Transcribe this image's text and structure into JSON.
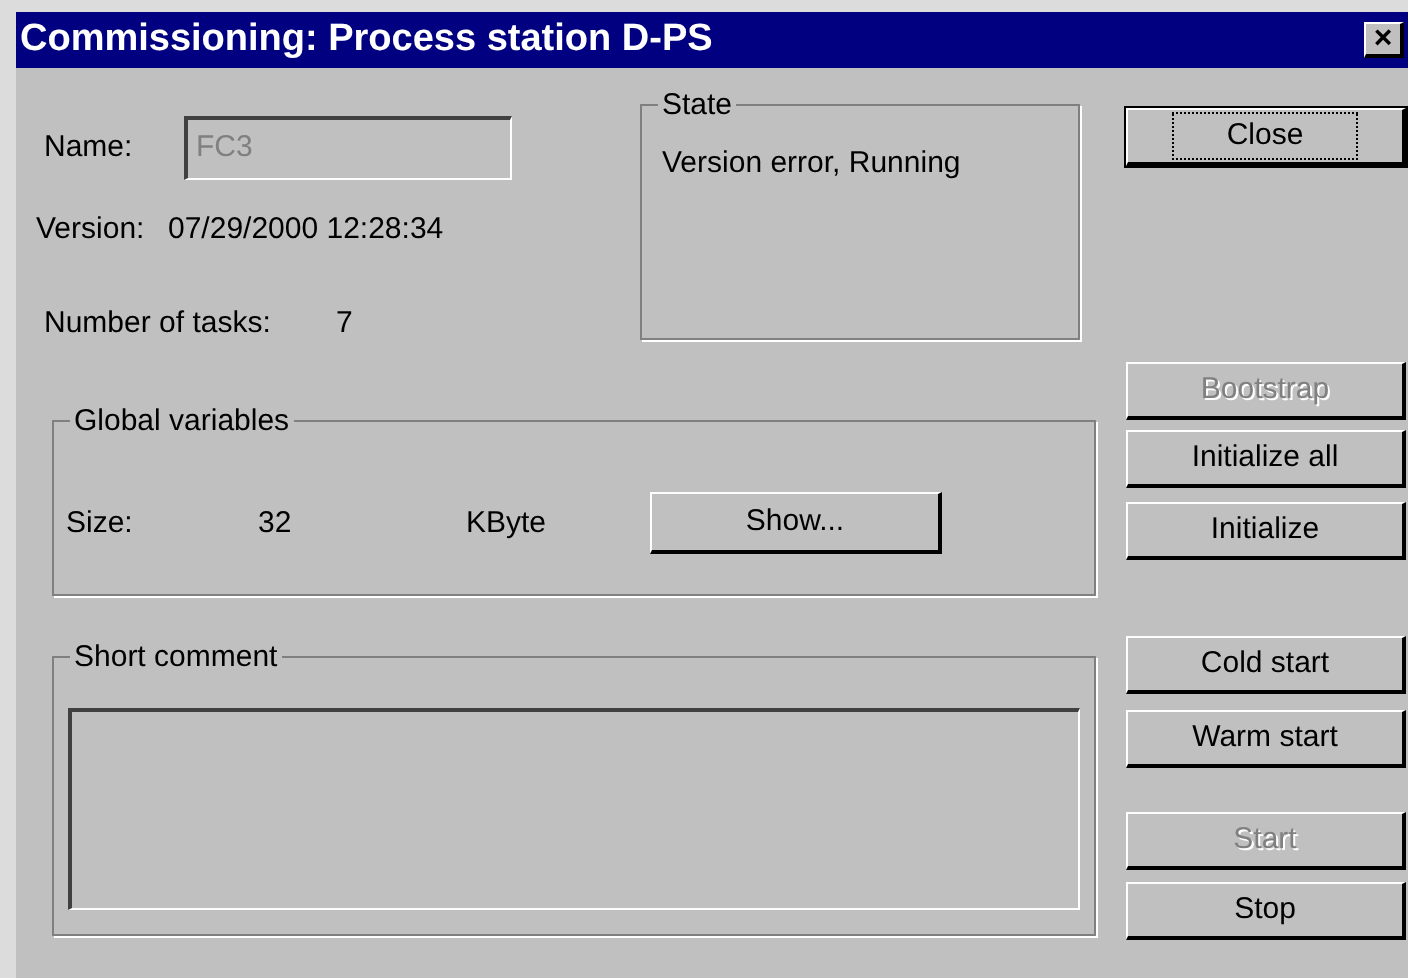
{
  "window": {
    "title": "Commissioning: Process station D-PS",
    "close_symbol": "×"
  },
  "name_field": {
    "label": "Name:",
    "value": "FC3",
    "disabled": true
  },
  "version": {
    "label": "Version:",
    "value": "07/29/2000 12:28:34"
  },
  "tasks": {
    "label": "Number of tasks:",
    "value": "7"
  },
  "state_group": {
    "title": "State",
    "text": "Version error, Running"
  },
  "global_variables": {
    "title": "Global variables",
    "size_label": "Size:",
    "size_value": "32",
    "unit": "KByte",
    "button": "Show..."
  },
  "short_comment": {
    "title": "Short comment"
  },
  "buttons": [
    {
      "label": "Close",
      "disabled": false,
      "default": true
    },
    {
      "label": "Bootstrap",
      "disabled": true,
      "default": false
    },
    {
      "label": "Initialize all",
      "disabled": false,
      "default": false
    },
    {
      "label": "Initialize",
      "disabled": false,
      "default": false
    },
    {
      "label": "Cold start",
      "disabled": false,
      "default": false
    },
    {
      "label": "Warm start",
      "disabled": false,
      "default": false
    },
    {
      "label": "Start",
      "disabled": true,
      "default": false
    },
    {
      "label": "Stop",
      "disabled": false,
      "default": false
    }
  ]
}
